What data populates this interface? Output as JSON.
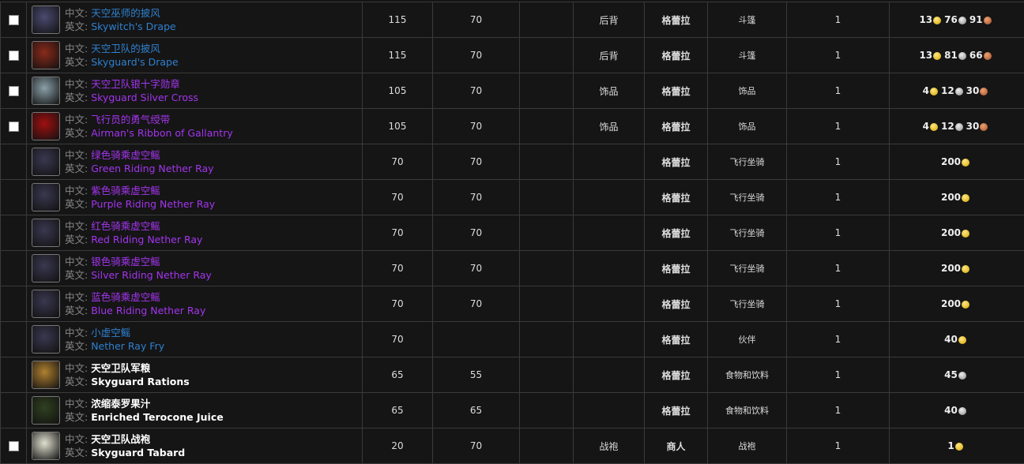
{
  "labels": {
    "cn": "中文:",
    "en": "英文:"
  },
  "quality_colors": {
    "rare": "#2f80d0",
    "epic": "#a335ee",
    "common": "#ffffff"
  },
  "rows": [
    {
      "checkbox": true,
      "icon": "skywitch-drape-icon",
      "icon_color": "#4a4a70",
      "quality": "rare",
      "cn": "天空巫师的披风",
      "en": "Skywitch's Drape",
      "c1": "115",
      "c2": "70",
      "c3": "",
      "slot": "后背",
      "source": "格蕾拉",
      "type": "斗篷",
      "qty": "1",
      "gold": "13",
      "silver": "76",
      "copper": "91"
    },
    {
      "checkbox": true,
      "icon": "skyguard-drape-icon",
      "icon_color": "#8a2a1a",
      "quality": "rare",
      "cn": "天空卫队的披风",
      "en": "Skyguard's Drape",
      "c1": "115",
      "c2": "70",
      "c3": "",
      "slot": "后背",
      "source": "格蕾拉",
      "type": "斗篷",
      "qty": "1",
      "gold": "13",
      "silver": "81",
      "copper": "66"
    },
    {
      "checkbox": true,
      "icon": "silver-cross-icon",
      "icon_color": "#8aa0a8",
      "quality": "epic",
      "cn": "天空卫队银十字勋章",
      "en": "Skyguard Silver Cross",
      "c1": "105",
      "c2": "70",
      "c3": "",
      "slot": "饰品",
      "source": "格蕾拉",
      "type": "饰品",
      "qty": "1",
      "gold": "4",
      "silver": "12",
      "copper": "30"
    },
    {
      "checkbox": true,
      "icon": "ribbon-icon",
      "icon_color": "#a01010",
      "quality": "epic",
      "cn": "飞行员的勇气绶带",
      "en": "Airman's Ribbon of Gallantry",
      "c1": "105",
      "c2": "70",
      "c3": "",
      "slot": "饰品",
      "source": "格蕾拉",
      "type": "饰品",
      "qty": "1",
      "gold": "4",
      "silver": "12",
      "copper": "30"
    },
    {
      "checkbox": false,
      "icon": "nether-ray-icon",
      "icon_color": "#3a3850",
      "quality": "epic",
      "cn": "绿色骑乘虚空鳐",
      "en": "Green Riding Nether Ray",
      "c1": "70",
      "c2": "70",
      "c3": "",
      "slot": "",
      "source": "格蕾拉",
      "type": "飞行坐骑",
      "qty": "1",
      "gold": "200",
      "silver": "",
      "copper": ""
    },
    {
      "checkbox": false,
      "icon": "nether-ray-icon",
      "icon_color": "#3a3850",
      "quality": "epic",
      "cn": "紫色骑乘虚空鳐",
      "en": "Purple Riding Nether Ray",
      "c1": "70",
      "c2": "70",
      "c3": "",
      "slot": "",
      "source": "格蕾拉",
      "type": "飞行坐骑",
      "qty": "1",
      "gold": "200",
      "silver": "",
      "copper": ""
    },
    {
      "checkbox": false,
      "icon": "nether-ray-icon",
      "icon_color": "#3a3850",
      "quality": "epic",
      "cn": "红色骑乘虚空鳐",
      "en": "Red Riding Nether Ray",
      "c1": "70",
      "c2": "70",
      "c3": "",
      "slot": "",
      "source": "格蕾拉",
      "type": "飞行坐骑",
      "qty": "1",
      "gold": "200",
      "silver": "",
      "copper": ""
    },
    {
      "checkbox": false,
      "icon": "nether-ray-icon",
      "icon_color": "#3a3850",
      "quality": "epic",
      "cn": "银色骑乘虚空鳐",
      "en": "Silver Riding Nether Ray",
      "c1": "70",
      "c2": "70",
      "c3": "",
      "slot": "",
      "source": "格蕾拉",
      "type": "飞行坐骑",
      "qty": "1",
      "gold": "200",
      "silver": "",
      "copper": ""
    },
    {
      "checkbox": false,
      "icon": "nether-ray-icon",
      "icon_color": "#3a3850",
      "quality": "epic",
      "cn": "蓝色骑乘虚空鳐",
      "en": "Blue Riding Nether Ray",
      "c1": "70",
      "c2": "70",
      "c3": "",
      "slot": "",
      "source": "格蕾拉",
      "type": "飞行坐骑",
      "qty": "1",
      "gold": "200",
      "silver": "",
      "copper": ""
    },
    {
      "checkbox": false,
      "icon": "nether-ray-icon",
      "icon_color": "#3a3850",
      "quality": "rare",
      "cn": "小虚空鳐",
      "en": "Nether Ray Fry",
      "c1": "70",
      "c2": "",
      "c3": "",
      "slot": "",
      "source": "格蕾拉",
      "type": "伙伴",
      "qty": "1",
      "gold": "40",
      "silver": "",
      "copper": ""
    },
    {
      "checkbox": false,
      "icon": "rations-icon",
      "icon_color": "#b08030",
      "quality": "common",
      "cn": "天空卫队军粮",
      "en": "Skyguard Rations",
      "c1": "65",
      "c2": "55",
      "c3": "",
      "slot": "",
      "source": "格蕾拉",
      "type": "食物和饮料",
      "qty": "1",
      "gold": "",
      "silver": "45",
      "copper": ""
    },
    {
      "checkbox": false,
      "icon": "juice-icon",
      "icon_color": "#304020",
      "quality": "common",
      "cn": "浓缩泰罗果汁",
      "en": "Enriched Terocone Juice",
      "c1": "65",
      "c2": "65",
      "c3": "",
      "slot": "",
      "source": "格蕾拉",
      "type": "食物和饮料",
      "qty": "1",
      "gold": "",
      "silver": "40",
      "copper": ""
    },
    {
      "checkbox": true,
      "icon": "tabard-icon",
      "icon_color": "#e0e0d0",
      "quality": "common",
      "cn": "天空卫队战袍",
      "en": "Skyguard Tabard",
      "c1": "20",
      "c2": "70",
      "c3": "",
      "slot": "战袍",
      "source": "商人",
      "type": "战袍",
      "qty": "1",
      "gold": "1",
      "silver": "",
      "copper": ""
    }
  ]
}
